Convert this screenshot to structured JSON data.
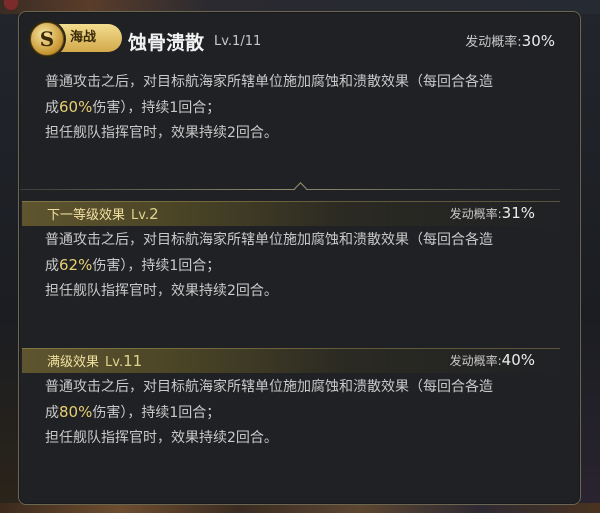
{
  "skill": {
    "category": "海战",
    "name": "蚀骨溃散",
    "level_label": "Lv.1/11",
    "rate_label": "发动概率:",
    "rate_value": "30%",
    "desc": {
      "line1": "普通攻击之后，对目标航海家所辖单位施加腐蚀和溃散效果（每回合各造",
      "line2_pre": "成",
      "line2_value": "60%",
      "line2_post": "伤害），持续1回合；",
      "line3": "担任舰队指挥官时，效果持续2回合。"
    }
  },
  "next_level": {
    "title": "下一等级效果",
    "lv_prefix": "Lv.",
    "lv_num": "2",
    "rate_label": "发动概率:",
    "rate_value": "31%",
    "desc": {
      "line1": "普通攻击之后，对目标航海家所辖单位施加腐蚀和溃散效果（每回合各造",
      "line2_pre": "成",
      "line2_value": "62%",
      "line2_post": "伤害），持续1回合；",
      "line3": "担任舰队指挥官时，效果持续2回合。"
    }
  },
  "max_level": {
    "title": "满级效果",
    "lv_prefix": "Lv.",
    "lv_num": "11",
    "rate_label": "发动概率:",
    "rate_value": "40%",
    "desc": {
      "line1": "普通攻击之后，对目标航海家所辖单位施加腐蚀和溃散效果（每回合各造",
      "line2_pre": "成",
      "line2_value": "80%",
      "line2_post": "伤害），持续1回合；",
      "line3": "担任舰队指挥官时，效果持续2回合。"
    }
  },
  "icons": {
    "badge": "s-rank-icon",
    "badge_letter": "S"
  },
  "colors": {
    "highlight": "#e7cf72",
    "panel": "#1f2124",
    "border": "#6a6652"
  }
}
